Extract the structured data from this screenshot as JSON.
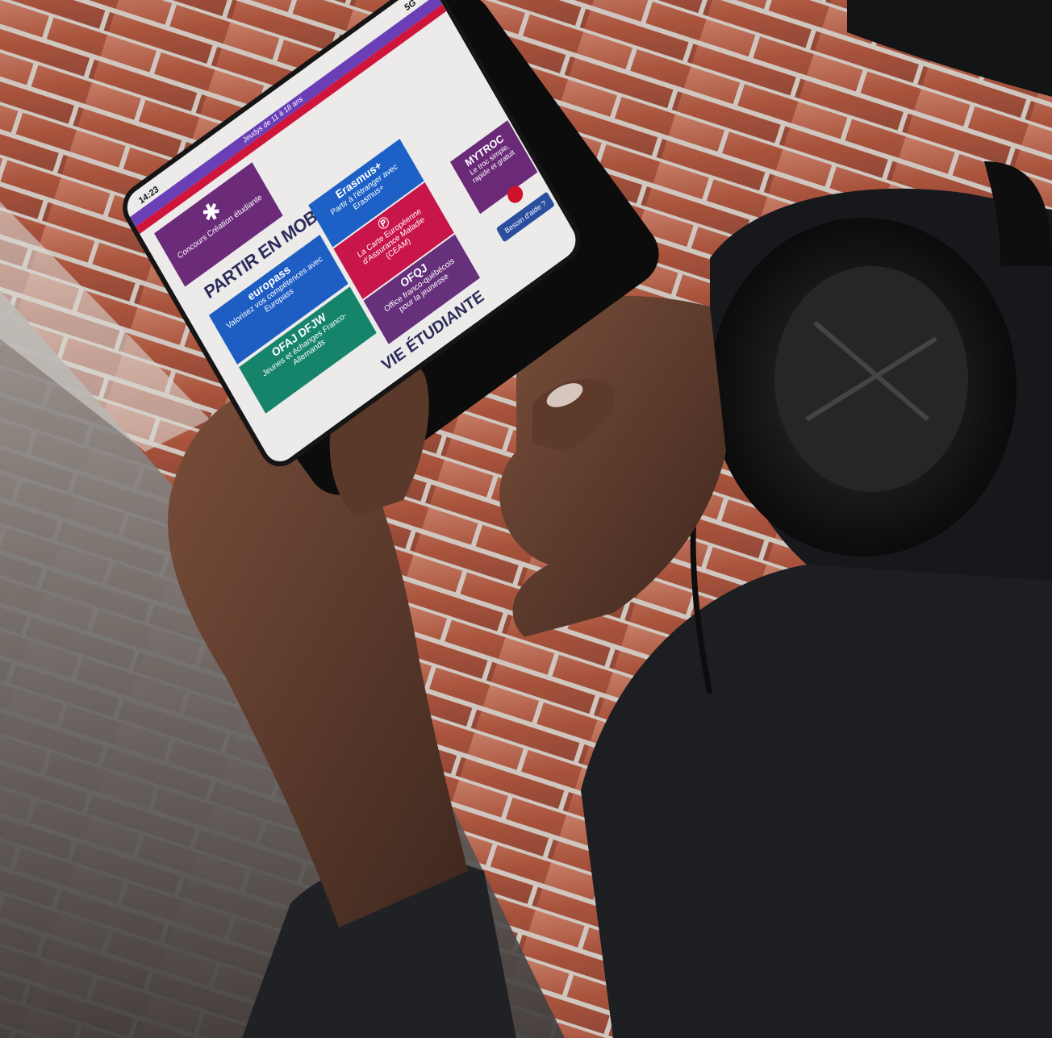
{
  "phone": {
    "status_time": "14:23",
    "status_signal": "5G",
    "topbar_text": "Jeudys de 11 à 18 ans"
  },
  "tiles": {
    "concours": "Concours Création étudiante",
    "section_mobilite": "PARTIR EN MOBILITÉ",
    "erasmus_brand": "Erasmus+",
    "erasmus_text": "Partir à l'étranger avec Erasmus+",
    "europass_brand": "europass",
    "europass_text": "Valorisez vos compétences avec Europass",
    "cram_text": "La Carte Européenne d'Assurance Maladie (CEAM)",
    "ofaj_brand": "OFAJ DFJW",
    "ofaj_text": "Jeunes et échanges Franco-Allemands",
    "ofqj_brand": "OFQJ",
    "ofqj_text": "Office franco-québécois pour la jeunesse",
    "section_vie": "VIE ÉTUDIANTE",
    "mytroc_brand": "MYTROC",
    "mytroc_text": "Le troc simple, rapide et gratuit",
    "help_button": "Besoin d'aide ?"
  },
  "colors": {
    "brick": "#a9533c",
    "mortar": "#c8c2bb",
    "skin": "#5a3a2c",
    "jacket": "#1c1e22",
    "headphones": "#121212",
    "purple": "#6b2b79",
    "blue": "#1e5dc2",
    "red": "#c9164a",
    "green": "#16846a",
    "navy": "#2b2c59"
  }
}
